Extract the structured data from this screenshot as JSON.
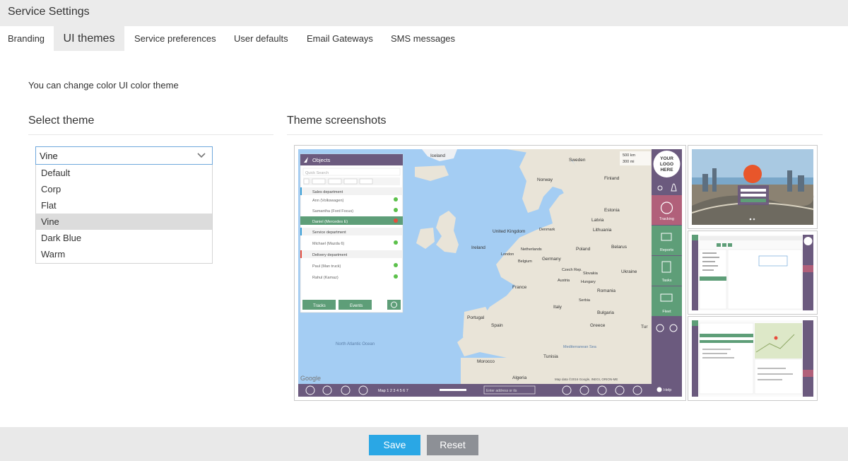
{
  "header": {
    "title": "Service Settings"
  },
  "tabs": [
    {
      "label": "Branding"
    },
    {
      "label": "UI themes"
    },
    {
      "label": "Service preferences"
    },
    {
      "label": "User defaults"
    },
    {
      "label": "Email Gateways"
    },
    {
      "label": "SMS messages"
    }
  ],
  "intro": "You can change color UI color theme",
  "select_section": {
    "title": "Select theme",
    "value": "Vine",
    "options": [
      "Default",
      "Corp",
      "Flat",
      "Vine",
      "Dark Blue",
      "Warm"
    ]
  },
  "screens_section": {
    "title": "Theme screenshots"
  },
  "preview": {
    "objects_title": "Objects",
    "quick_search": "Quick Search",
    "groups": [
      {
        "name": "Sales department",
        "members": [
          "Ann (Volkswagen)",
          "Samantha (Ford Focus)",
          "Daniel (Mercedes E)"
        ]
      },
      {
        "name": "Service department",
        "members": [
          "Michael (Mazda 6)"
        ]
      },
      {
        "name": "Delivery department",
        "members": [
          "Paul (Man truck)",
          "Rahul (Kamaz)"
        ]
      }
    ],
    "tracks_label": "Tracks",
    "events_label": "Events",
    "logo_text": [
      "YOUR",
      "LOGO",
      "HERE"
    ],
    "side_menu": [
      "Tracking",
      "Reports",
      "Tasks",
      "Fleet"
    ],
    "help_label": "Help",
    "map_tabs": "Map 1 2 3 4 5 6 7",
    "address_placeholder": "Enter address or its",
    "google": "Google",
    "copyright": "Map data ©2016 Google, INEGI, ORION-ME",
    "scale": [
      "500 km",
      "300 mi"
    ],
    "places": [
      "Iceland",
      "Sweden",
      "Finland",
      "Norway",
      "Estonia",
      "Latvia",
      "Lithuania",
      "Denmark",
      "United Kingdom",
      "Ireland",
      "London",
      "Netherlands",
      "Belgium",
      "Germany",
      "Poland",
      "Belarus",
      "Czech Rep.",
      "Slovakia",
      "Ukraine",
      "Austria",
      "Hungary",
      "France",
      "Romania",
      "Italy",
      "Serbia",
      "Bulgaria",
      "Portugal",
      "Spain",
      "Greece",
      "Tur",
      "Morocco",
      "Algeria",
      "Tunisia",
      "North Atlantic Ocean",
      "Mediterranean Sea"
    ]
  },
  "buttons": {
    "save": "Save",
    "reset": "Reset"
  }
}
